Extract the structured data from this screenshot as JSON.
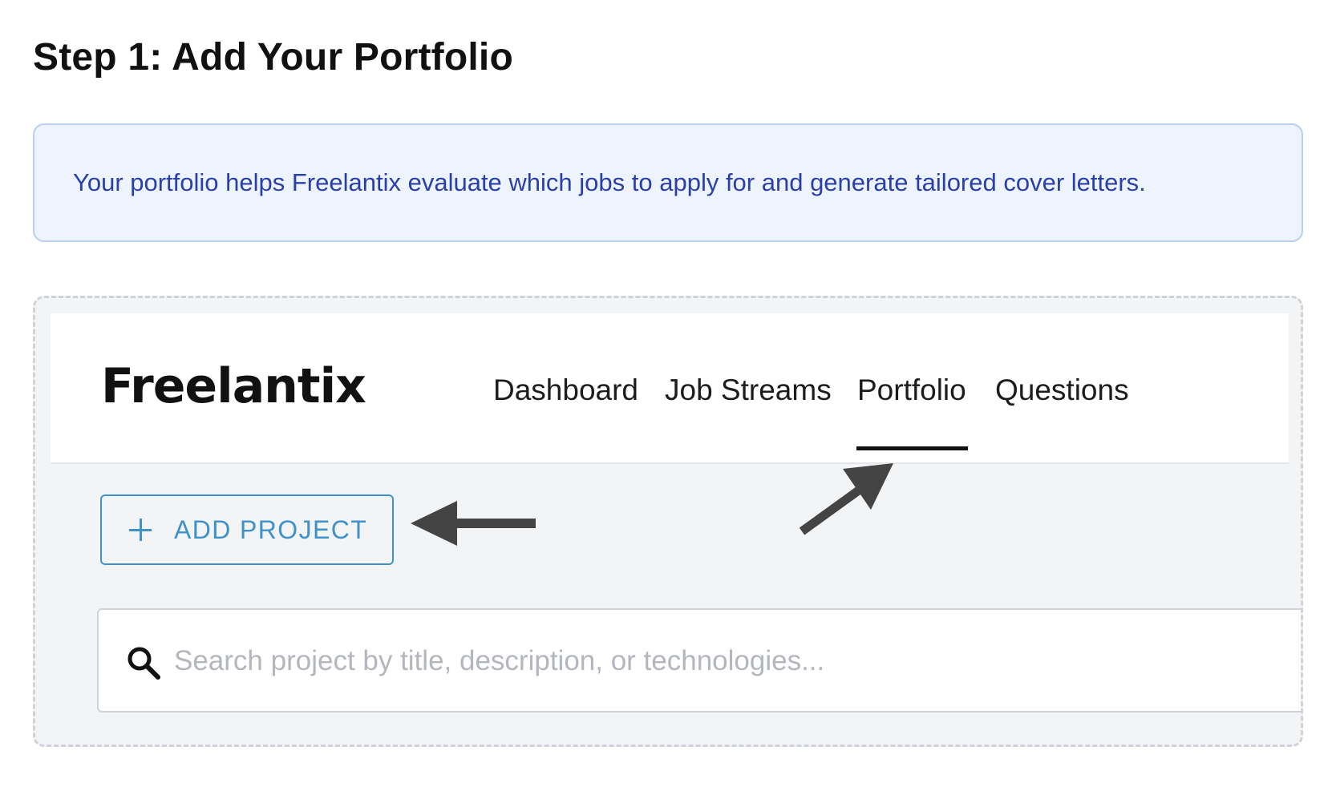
{
  "step": {
    "title": "Step 1: Add Your Portfolio"
  },
  "info": {
    "text": "Your portfolio helps Freelantix evaluate which jobs to apply for and generate tailored cover letters."
  },
  "app": {
    "logo": "Freelantix",
    "nav": [
      {
        "label": "Dashboard",
        "active": false
      },
      {
        "label": "Job Streams",
        "active": false
      },
      {
        "label": "Portfolio",
        "active": true
      },
      {
        "label": "Questions",
        "active": false
      }
    ],
    "add_project": {
      "icon": "plus-icon",
      "label": "ADD PROJECT"
    },
    "search": {
      "icon": "search-icon",
      "placeholder": "Search project by title, description, or technologies...",
      "value": ""
    }
  },
  "colors": {
    "info_background": "#eef4fd",
    "info_text": "#2b3fa8",
    "accent": "#3f92c9",
    "annotation_arrow": "#444444"
  },
  "annotations": [
    {
      "icon": "arrow-left-icon",
      "points_to": "add-project-button"
    },
    {
      "icon": "arrow-up-right-icon",
      "points_to": "nav-item-portfolio"
    }
  ]
}
